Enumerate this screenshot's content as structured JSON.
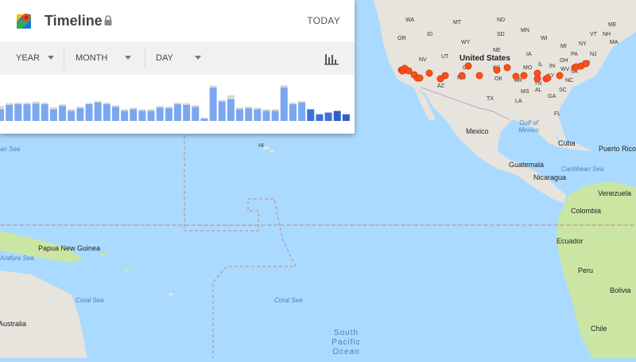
{
  "timeline": {
    "title": "Timeline",
    "today_label": "TODAY",
    "filters": [
      {
        "label": "YEAR"
      },
      {
        "label": "MONTH"
      },
      {
        "label": "DAY"
      }
    ],
    "histogram": {
      "bar_color": "#7ba7f0",
      "bar_color_light": "#d9d9d9",
      "bar_color_dark": "#2f5fc7",
      "values": [
        0.35,
        0.48,
        0.5,
        0.5,
        0.52,
        0.5,
        0.35,
        0.45,
        0.3,
        0.38,
        0.5,
        0.55,
        0.5,
        0.42,
        0.3,
        0.35,
        0.3,
        0.3,
        0.4,
        0.38,
        0.5,
        0.48,
        0.42,
        0.08,
        1.0,
        0.58,
        0.65,
        0.35,
        0.38,
        0.35,
        0.3,
        0.3,
        1.0,
        0.5,
        0.55,
        0.35,
        0.2,
        0.25,
        0.3,
        0.2
      ],
      "extra": [
        0.1,
        0.06,
        0.05,
        0.05,
        0.06,
        0.05,
        0.06,
        0.05,
        0.05,
        0.05,
        0.04,
        0.05,
        0.05,
        0.05,
        0.05,
        0.05,
        0.05,
        0.05,
        0.05,
        0.05,
        0.05,
        0.05,
        0.05,
        0,
        0.06,
        0.05,
        0.12,
        0.05,
        0.05,
        0.05,
        0.05,
        0.05,
        0.07,
        0.05,
        0.05,
        0,
        0,
        0,
        0,
        0
      ],
      "dark_from_index": 35
    }
  },
  "map": {
    "land_color": "#e6e4dc",
    "green_color": "#cbe6a3",
    "water_color": "#aadaff",
    "pin_color": "#f4511e",
    "countries": [
      "Mexico",
      "Cuba",
      "Puerto Rico",
      "Guatemala",
      "Nicaragua",
      "Venezuela",
      "Colombia",
      "Ecuador",
      "Peru",
      "Bolivia",
      "Chile",
      "Papua New Guinea",
      "Australia",
      "United States"
    ],
    "states": [
      "WA",
      "NV",
      "UT",
      "CO",
      "KS",
      "MO",
      "WV",
      "VA",
      "NC",
      "SC",
      "GA",
      "AL",
      "MS",
      "TX",
      "AZ",
      "OR",
      "ID",
      "MT",
      "ND",
      "SD",
      "NE",
      "MN",
      "WI",
      "MI",
      "IA",
      "IL",
      "IN",
      "OH",
      "PA",
      "NY",
      "ME",
      "VT",
      "NH",
      "MA",
      "NJ",
      "DE",
      "KY",
      "TN",
      "AR",
      "LA",
      "OK",
      "NM",
      "WY",
      "FL",
      "HI"
    ],
    "waters": [
      "Gulf of Mexico",
      "Caribbean Sea",
      "Coral Sea",
      "Arafura Sea",
      "Coral Sea",
      "an Sea"
    ],
    "ocean_label": [
      "South",
      "Pacific",
      "Ocean"
    ],
    "pins_lonlat": [
      [
        -122.4,
        37.8
      ],
      [
        -122.2,
        37.5
      ],
      [
        -121.9,
        37.3
      ],
      [
        -121.5,
        38.6
      ],
      [
        -120.6,
        37.5
      ],
      [
        -119.0,
        35.4
      ],
      [
        -118.2,
        34.0
      ],
      [
        -117.5,
        34.1
      ],
      [
        -115.1,
        36.2
      ],
      [
        -112.1,
        33.5
      ],
      [
        -111.0,
        35.2
      ],
      [
        -106.6,
        35.1
      ],
      [
        -104.9,
        39.7
      ],
      [
        -101.9,
        35.2
      ],
      [
        -97.3,
        37.7
      ],
      [
        -94.6,
        39.1
      ],
      [
        -92.3,
        34.7
      ],
      [
        -90.2,
        35.1
      ],
      [
        -86.8,
        36.2
      ],
      [
        -86.8,
        33.5
      ],
      [
        -84.4,
        33.7
      ],
      [
        -84.0,
        33.8
      ],
      [
        -80.8,
        35.2
      ],
      [
        -77.0,
        38.9
      ],
      [
        -76.6,
        39.3
      ],
      [
        -75.2,
        39.9
      ],
      [
        -74.0,
        40.7
      ]
    ]
  }
}
